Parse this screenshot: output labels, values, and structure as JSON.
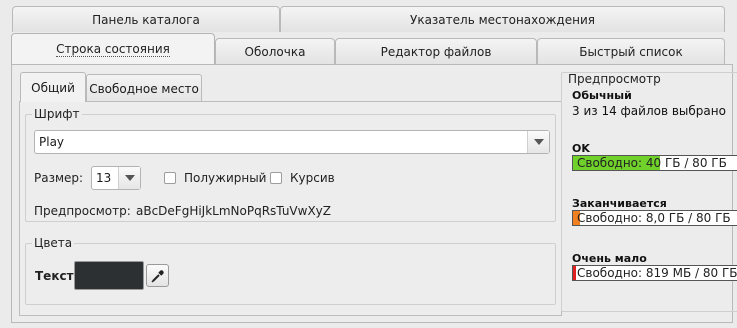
{
  "top_tabs": {
    "row1": [
      "Панель каталога",
      "Указатель местонахождения"
    ],
    "row2": [
      "Строка состояния",
      "Оболочка",
      "Редактор файлов",
      "Быстрый список"
    ]
  },
  "inner_tabs": [
    "Общий",
    "Свободное место"
  ],
  "font_group": {
    "title": "Шрифт",
    "font_value": "Play",
    "size_label": "Размер:",
    "size_value": "13",
    "bold_label": "Полужирный",
    "italic_label": "Курсив",
    "preview_label": "Предпросмотр:",
    "preview_sample": "aBcDeFgHiJkLmNoPqRsTuVwXyZ"
  },
  "colors_group": {
    "title": "Цвета",
    "text_label": "Текст",
    "text_color": "#2c3033"
  },
  "preview": {
    "title": "Предпросмотр",
    "normal_title": "Обычный",
    "normal_text": "3 из 14 файлов выбрано",
    "ok_title": "OK",
    "ok_bar_text": "Свободно: 40 ГБ / 80 ГБ",
    "ok_fill_fraction": 0.5,
    "ok_color": "#6fd12a",
    "warn_title": "Заканчивается",
    "warn_bar_text": "Свободно: 8,0 ГБ / 80 ГБ",
    "warn_fill_fraction": 0.04,
    "warn_color": "#f08020",
    "crit_title": "Очень мало",
    "crit_bar_text": "Свободно: 819 МБ / 80 ГБ",
    "crit_fill_fraction": 0.01,
    "crit_color": "#e02020"
  }
}
